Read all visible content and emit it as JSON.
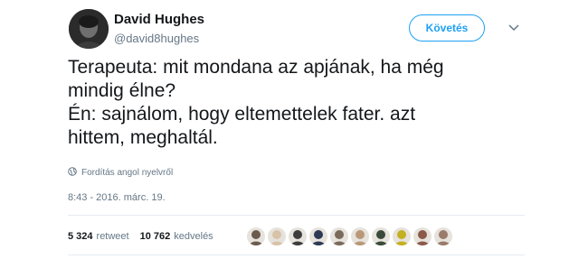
{
  "author": {
    "name": "David Hughes",
    "handle": "@david8hughes"
  },
  "follow_button": {
    "label": "Követés",
    "color": "#1da1f2"
  },
  "tweet": {
    "lines": [
      "Terapeuta: mit mondana az apjának, ha még",
      "mindig élne?",
      "Én: sajnálom, hogy eltemettelek fater. azt",
      "hittem, meghaltál."
    ]
  },
  "translate_label": "Fordítás angol nyelvről",
  "timestamp": "8:43 - 2016. márc. 19.",
  "stats": {
    "retweets": {
      "count": "5 324",
      "label": "retweet"
    },
    "likes": {
      "count": "10 762",
      "label": "kedvelés"
    }
  },
  "likers": [
    {
      "color": "#6b5a4e"
    },
    {
      "color": "#d8c3a8"
    },
    {
      "color": "#3d3d3d"
    },
    {
      "color": "#2d3a55"
    },
    {
      "color": "#7a6a5c"
    },
    {
      "color": "#b89878"
    },
    {
      "color": "#3a4a3a"
    },
    {
      "color": "#c4b020"
    },
    {
      "color": "#8a5a4a"
    },
    {
      "color": "#9a7a6a"
    }
  ]
}
